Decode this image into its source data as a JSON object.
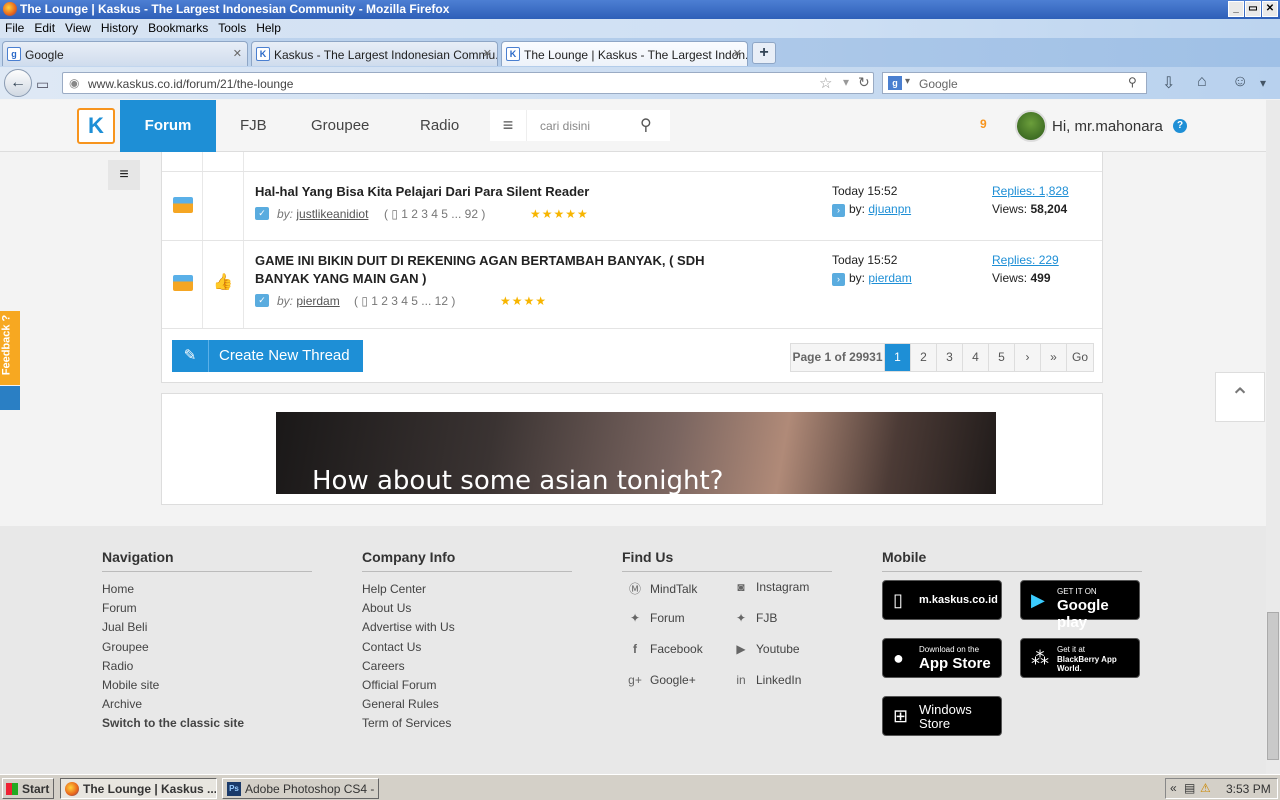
{
  "window": {
    "title": "The Lounge | Kaskus - The Largest Indonesian Community - Mozilla Firefox",
    "minimize": "_",
    "maximize": "▭",
    "close": "✕"
  },
  "menubar": [
    "File",
    "Edit",
    "View",
    "History",
    "Bookmarks",
    "Tools",
    "Help"
  ],
  "tabs": [
    {
      "label": "Google",
      "favicon": "g-icon"
    },
    {
      "label": "Kaskus - The Largest Indonesian Commu...",
      "favicon": "kaskus-icon"
    },
    {
      "label": "The Lounge | Kaskus - The Largest Indon...",
      "favicon": "kaskus-icon"
    }
  ],
  "newtab": "+",
  "nav": {
    "url": "www.kaskus.co.id/forum/21/the-lounge",
    "search_placeholder": "Google"
  },
  "site": {
    "logo": "K",
    "nav": [
      "Forum",
      "FJB",
      "Groupee",
      "Radio"
    ],
    "search_placeholder": "cari disini",
    "notif_count": "9",
    "greeting": "Hi, mr.mahonara",
    "help": "?"
  },
  "threads": [
    {
      "title": "Hal-hal Yang Bisa Kita Pelajari Dari Para Silent Reader",
      "by_prefix": "by:",
      "author": "justlikeanidiot",
      "pages": "( ▯ 1   2   3   4   5 ... 92 )",
      "stars": "★★★★★",
      "last_time": "Today 15:52",
      "last_by_prefix": "by:",
      "last_by": "djuanpn",
      "replies": "Replies: 1,828",
      "views_label": "Views:",
      "views": "58,204"
    },
    {
      "title": "GAME INI BIKIN DUIT DI REKENING AGAN BERTAMBAH BANYAK, ( SDH BANYAK YANG MAIN GAN )",
      "by_prefix": "by:",
      "author": "pierdam",
      "pages": "( ▯ 1   2   3   4   5 ... 12 )",
      "stars": "★★★★",
      "last_time": "Today 15:52",
      "last_by_prefix": "by:",
      "last_by": "pierdam",
      "replies": "Replies: 229",
      "views_label": "Views:",
      "views": "499"
    }
  ],
  "create_thread": "Create New Thread",
  "pager": {
    "info": "Page 1 of 29931",
    "pages": [
      "1",
      "2",
      "3",
      "4",
      "5"
    ],
    "next": "›",
    "last": "»",
    "go": "Go"
  },
  "ad": {
    "text": "How about some asian tonight?"
  },
  "feedback": "Feedback ?",
  "footer": {
    "navigation": {
      "heading": "Navigation",
      "links": [
        "Home",
        "Forum",
        "Jual Beli",
        "Groupee",
        "Radio",
        "Mobile site",
        "Archive",
        "Switch to the classic site"
      ]
    },
    "company": {
      "heading": "Company Info",
      "links": [
        "Help Center",
        "About Us",
        "Advertise with Us",
        "Contact Us",
        "Careers",
        "Official Forum",
        "General Rules",
        "Term of Services"
      ]
    },
    "findus": {
      "heading": "Find Us",
      "left": [
        "MindTalk",
        "Forum",
        "Facebook",
        "Google+"
      ],
      "right": [
        "Instagram",
        "FJB",
        "Youtube",
        "LinkedIn"
      ]
    },
    "mobile": {
      "heading": "Mobile",
      "badges": [
        {
          "small": "",
          "big": "m.kaskus.co.id"
        },
        {
          "small": "GET IT ON",
          "big": "Google play"
        },
        {
          "small": "Download on the",
          "big": "App Store"
        },
        {
          "small": "Get it at",
          "big": "BlackBerry App World."
        },
        {
          "small": "",
          "big": "Windows Store"
        }
      ]
    }
  },
  "taskbar": {
    "start": "Start",
    "items": [
      "The Lounge | Kaskus ...",
      "Adobe Photoshop CS4 - ..."
    ],
    "clock": "3:53 PM"
  }
}
